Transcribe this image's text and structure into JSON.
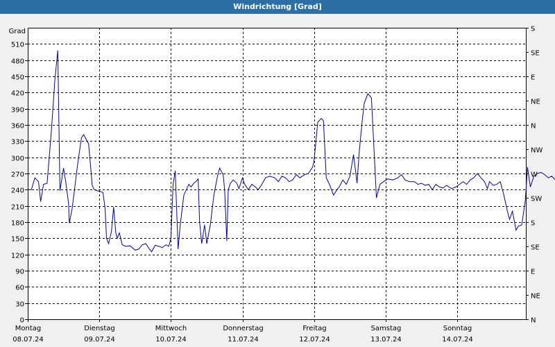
{
  "window": {
    "title": "Windrichtung [Grad]"
  },
  "chart_data": {
    "type": "line",
    "title": "Windrichtung [Grad]",
    "ylabel": "Grad",
    "ylim": [
      0,
      540
    ],
    "yticks": [
      0,
      30,
      60,
      90,
      120,
      150,
      180,
      210,
      240,
      270,
      300,
      330,
      360,
      390,
      420,
      450,
      480,
      510
    ],
    "right_axis_labels": [
      "N",
      "NE",
      "E",
      "SE",
      "S",
      "SW",
      "W",
      "NW",
      "N",
      "NE",
      "E",
      "SE",
      "S"
    ],
    "x_categories": [
      {
        "day": "Montag",
        "date": "08.07.24"
      },
      {
        "day": "Dienstag",
        "date": "09.07.24"
      },
      {
        "day": "Mittwoch",
        "date": "10.07.24"
      },
      {
        "day": "Donnerstag",
        "date": "11.07.24"
      },
      {
        "day": "Freitag",
        "date": "12.07.24"
      },
      {
        "day": "Samstag",
        "date": "13.07.24"
      },
      {
        "day": "Sonntag",
        "date": "14.07.24"
      }
    ],
    "x_range_days": [
      0,
      7
    ],
    "grid": true,
    "series": [
      {
        "color": "#0000aa",
        "points": [
          [
            0.0,
            240
          ],
          [
            0.05,
            240
          ],
          [
            0.1,
            262
          ],
          [
            0.15,
            255
          ],
          [
            0.18,
            218
          ],
          [
            0.22,
            250
          ],
          [
            0.27,
            252
          ],
          [
            0.33,
            350
          ],
          [
            0.38,
            445
          ],
          [
            0.42,
            498
          ],
          [
            0.45,
            238
          ],
          [
            0.5,
            280
          ],
          [
            0.53,
            255
          ],
          [
            0.57,
            215
          ],
          [
            0.58,
            178
          ],
          [
            0.62,
            205
          ],
          [
            0.7,
            290
          ],
          [
            0.75,
            336
          ],
          [
            0.78,
            342
          ],
          [
            0.85,
            325
          ],
          [
            0.88,
            280
          ],
          [
            0.9,
            248
          ],
          [
            0.93,
            240
          ],
          [
            0.97,
            238
          ],
          [
            1.05,
            235
          ],
          [
            1.08,
            205
          ],
          [
            1.1,
            150
          ],
          [
            1.13,
            140
          ],
          [
            1.17,
            163
          ],
          [
            1.2,
            208
          ],
          [
            1.23,
            160
          ],
          [
            1.25,
            150
          ],
          [
            1.28,
            160
          ],
          [
            1.32,
            138
          ],
          [
            1.37,
            135
          ],
          [
            1.43,
            136
          ],
          [
            1.5,
            128
          ],
          [
            1.55,
            130
          ],
          [
            1.6,
            138
          ],
          [
            1.65,
            140
          ],
          [
            1.7,
            130
          ],
          [
            1.73,
            125
          ],
          [
            1.78,
            137
          ],
          [
            1.83,
            135
          ],
          [
            1.88,
            133
          ],
          [
            1.93,
            138
          ],
          [
            1.97,
            135
          ],
          [
            2.0,
            150
          ],
          [
            2.03,
            250
          ],
          [
            2.06,
            275
          ],
          [
            2.1,
            130
          ],
          [
            2.13,
            175
          ],
          [
            2.18,
            230
          ],
          [
            2.25,
            250
          ],
          [
            2.28,
            245
          ],
          [
            2.32,
            252
          ],
          [
            2.35,
            255
          ],
          [
            2.38,
            260
          ],
          [
            2.4,
            180
          ],
          [
            2.43,
            140
          ],
          [
            2.47,
            175
          ],
          [
            2.5,
            140
          ],
          [
            2.55,
            175
          ],
          [
            2.6,
            230
          ],
          [
            2.65,
            265
          ],
          [
            2.68,
            280
          ],
          [
            2.73,
            268
          ],
          [
            2.75,
            240
          ],
          [
            2.78,
            145
          ],
          [
            2.8,
            240
          ],
          [
            2.83,
            252
          ],
          [
            2.87,
            258
          ],
          [
            2.92,
            252
          ],
          [
            2.95,
            242
          ],
          [
            3.0,
            262
          ],
          [
            3.03,
            250
          ],
          [
            3.08,
            240
          ],
          [
            3.13,
            250
          ],
          [
            3.18,
            245
          ],
          [
            3.22,
            240
          ],
          [
            3.27,
            250
          ],
          [
            3.32,
            262
          ],
          [
            3.38,
            265
          ],
          [
            3.45,
            262
          ],
          [
            3.5,
            255
          ],
          [
            3.55,
            265
          ],
          [
            3.6,
            262
          ],
          [
            3.65,
            255
          ],
          [
            3.7,
            258
          ],
          [
            3.75,
            268
          ],
          [
            3.8,
            262
          ],
          [
            3.87,
            268
          ],
          [
            3.92,
            270
          ],
          [
            3.98,
            282
          ],
          [
            4.0,
            295
          ],
          [
            4.05,
            365
          ],
          [
            4.1,
            372
          ],
          [
            4.13,
            368
          ],
          [
            4.17,
            262
          ],
          [
            4.22,
            248
          ],
          [
            4.27,
            230
          ],
          [
            4.32,
            240
          ],
          [
            4.35,
            245
          ],
          [
            4.4,
            258
          ],
          [
            4.45,
            250
          ],
          [
            4.5,
            265
          ],
          [
            4.55,
            305
          ],
          [
            4.6,
            252
          ],
          [
            4.63,
            310
          ],
          [
            4.67,
            365
          ],
          [
            4.7,
            400
          ],
          [
            4.75,
            418
          ],
          [
            4.8,
            410
          ],
          [
            4.83,
            330
          ],
          [
            4.87,
            225
          ],
          [
            4.92,
            250
          ],
          [
            4.97,
            255
          ],
          [
            5.03,
            260
          ],
          [
            5.1,
            258
          ],
          [
            5.17,
            262
          ],
          [
            5.22,
            268
          ],
          [
            5.27,
            258
          ],
          [
            5.33,
            255
          ],
          [
            5.4,
            255
          ],
          [
            5.45,
            250
          ],
          [
            5.5,
            252
          ],
          [
            5.55,
            248
          ],
          [
            5.6,
            250
          ],
          [
            5.65,
            240
          ],
          [
            5.7,
            250
          ],
          [
            5.75,
            245
          ],
          [
            5.8,
            243
          ],
          [
            5.85,
            248
          ],
          [
            5.92,
            242
          ],
          [
            5.98,
            245
          ],
          [
            6.03,
            250
          ],
          [
            6.08,
            255
          ],
          [
            6.13,
            250
          ],
          [
            6.18,
            258
          ],
          [
            6.23,
            262
          ],
          [
            6.28,
            270
          ],
          [
            6.33,
            262
          ],
          [
            6.38,
            255
          ],
          [
            6.42,
            242
          ],
          [
            6.45,
            255
          ],
          [
            6.5,
            248
          ],
          [
            6.55,
            250
          ],
          [
            6.6,
            255
          ],
          [
            6.65,
            230
          ],
          [
            6.7,
            200
          ],
          [
            6.73,
            185
          ],
          [
            6.77,
            200
          ],
          [
            6.82,
            165
          ],
          [
            6.85,
            172
          ],
          [
            6.9,
            175
          ],
          [
            6.95,
            220
          ],
          [
            6.98,
            282
          ],
          [
            7.02,
            245
          ],
          [
            7.07,
            265
          ],
          [
            7.12,
            270
          ],
          [
            7.17,
            272
          ],
          [
            7.22,
            268
          ],
          [
            7.27,
            262
          ],
          [
            7.32,
            265
          ],
          [
            7.37,
            258
          ],
          [
            7.42,
            245
          ],
          [
            7.47,
            235
          ],
          [
            7.52,
            242
          ],
          [
            7.55,
            245
          ]
        ]
      }
    ]
  }
}
